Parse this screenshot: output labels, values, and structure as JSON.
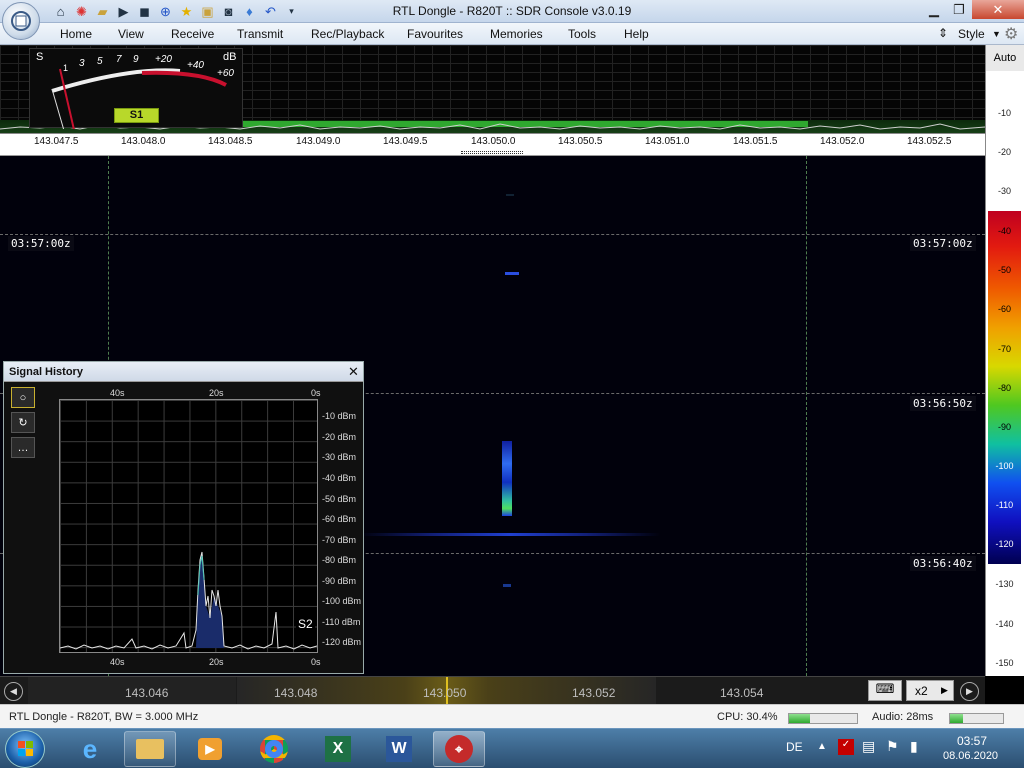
{
  "window": {
    "title": "RTL Dongle - R820T :: SDR Console v3.0.19",
    "style_label": "Style"
  },
  "menu": [
    "Home",
    "View",
    "Receive",
    "Transmit",
    "Rec/Playback",
    "Favourites",
    "Memories",
    "Tools",
    "Help"
  ],
  "smeter": {
    "s_label": "S",
    "db_label": "dB",
    "scale": [
      "1",
      "3",
      "5",
      "7",
      "9",
      "+20",
      "+40",
      "+60"
    ],
    "reading": "S1"
  },
  "frequency_scale": [
    "143.047.5",
    "143.048.0",
    "143.048.5",
    "143.049.0",
    "143.049.5",
    "143.050.0",
    "143.050.5",
    "143.051.0",
    "143.051.5",
    "143.052.0",
    "143.052.5"
  ],
  "right_scale": {
    "auto_label": "Auto",
    "ticks": [
      "-10",
      "-20",
      "-30",
      "-40",
      "-50",
      "-60",
      "-70",
      "-80",
      "-90",
      "-100",
      "-110",
      "-120",
      "-130",
      "-140",
      "-150"
    ]
  },
  "waterfall": {
    "timestamps": [
      "03:57:00z",
      "03:56:50z",
      "03:56:40z"
    ]
  },
  "signal_history": {
    "title": "Signal History",
    "x_labels_top": [
      "40s",
      "20s",
      "0s"
    ],
    "x_labels_bottom": [
      "40s",
      "20s",
      "0s"
    ],
    "db_labels": [
      "-10 dBm",
      "-20 dBm",
      "-30 dBm",
      "-40 dBm",
      "-50 dBm",
      "-60 dBm",
      "-70 dBm",
      "-80 dBm",
      "-90 dBm",
      "-100 dBm",
      "-110 dBm",
      "-120 dBm"
    ],
    "s_reading": "S2"
  },
  "tuning": {
    "labels": [
      "143.046",
      "143.048",
      "143.050",
      "143.052",
      "143.054"
    ],
    "zoom": "x2"
  },
  "status": {
    "device": "RTL Dongle - R820T, BW = 3.000 MHz",
    "cpu": "CPU: 30.4%",
    "cpu_fraction": 0.304,
    "audio": "Audio: 28ms",
    "audio_fraction": 0.25
  },
  "taskbar": {
    "language": "DE",
    "time": "03:57",
    "date": "08.06.2020"
  },
  "colors": {
    "spectrum_green": "#2fa82f",
    "smeter_red": "#c8102e",
    "s_badge": "#b8d82a"
  }
}
